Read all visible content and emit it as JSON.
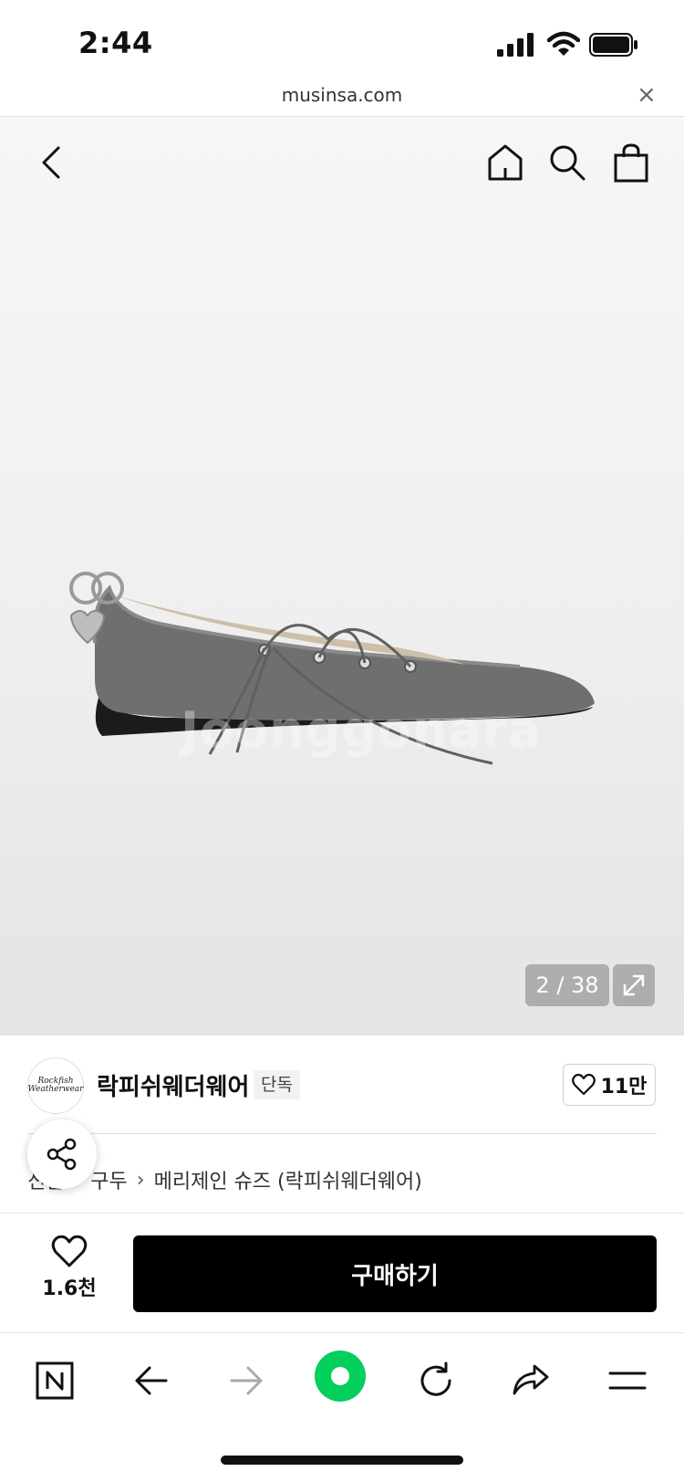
{
  "status_bar": {
    "time": "2:44"
  },
  "browser": {
    "url": "musinsa.com",
    "close_label": "×"
  },
  "gallery": {
    "current": 2,
    "total": 38,
    "counter_text": "2 / 38",
    "watermark": "Joonggonara"
  },
  "brand": {
    "name": "락피쉬웨더웨어",
    "badge": "단독",
    "likes": "11만",
    "logo_lines": [
      "Rockfish",
      "Weatherwear"
    ]
  },
  "breadcrumb": {
    "items": [
      "신발",
      "구두",
      "메리제인 슈즈 (락피쉬웨더웨어)"
    ]
  },
  "purchase": {
    "wish_count": "1.6천",
    "buy_label": "구매하기"
  },
  "icons": {
    "header": [
      "back-icon",
      "home-icon",
      "search-icon",
      "shopping-bag-icon"
    ],
    "toolbar": [
      "naver-icon",
      "arrow-left-icon",
      "arrow-right-icon",
      "green-dot-icon",
      "refresh-icon",
      "share-arrow-icon",
      "menu-icon"
    ]
  },
  "colors": {
    "buy_button": "#000000",
    "accent_green": "#03cf5d",
    "background": "#ffffff"
  }
}
